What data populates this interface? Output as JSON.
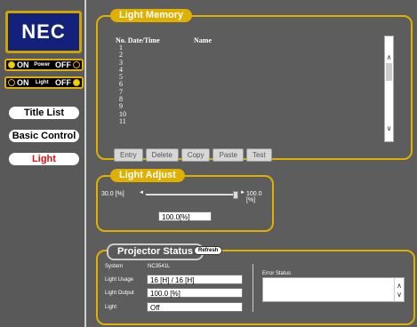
{
  "sidebar": {
    "logo": "NEC",
    "power": {
      "on": "ON",
      "label": "Power",
      "off": "OFF"
    },
    "light": {
      "on": "ON",
      "label": "Light",
      "off": "OFF"
    },
    "nav": [
      "Title List",
      "Basic Control",
      "Light"
    ]
  },
  "light_memory": {
    "title": "Light Memory",
    "col_no": "No. Date/Time",
    "col_name": "Name",
    "rows": [
      "1",
      "2",
      "3",
      "4",
      "5",
      "6",
      "7",
      "8",
      "9",
      "10",
      "11"
    ],
    "buttons": [
      "Entry",
      "Delete",
      "Copy",
      "Paste",
      "Test"
    ]
  },
  "light_adjust": {
    "title": "Light Adjust",
    "min_label": "30.0 [%]",
    "max_label": "100.0 [%]",
    "value": "100.0[%]",
    "level_fraction": 1.0
  },
  "projector_status": {
    "title": "Projector Status",
    "refresh": "Refresh",
    "system_label": "System",
    "system_value": "NC3541L",
    "usage_label": "Light Usage",
    "usage_value": "16 [H] / 16 [H]",
    "output_label": "Light Output",
    "output_value": "100.0 [%]",
    "light_label": "Light",
    "light_value": "Off",
    "error_label": "Error Status"
  },
  "colors": {
    "accent": "#e0b000",
    "logo_bg": "#14217a",
    "active_nav": "#e01010"
  }
}
